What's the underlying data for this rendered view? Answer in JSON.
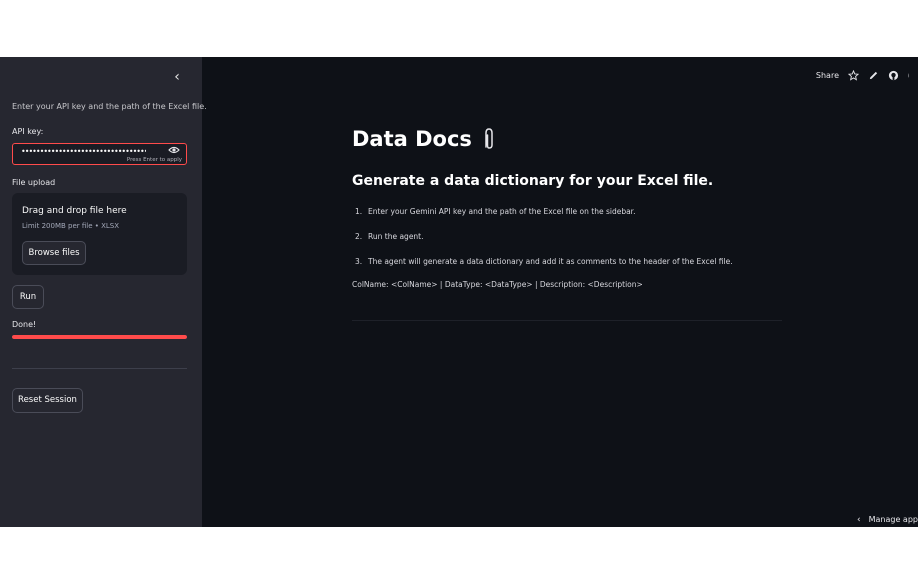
{
  "sidebar": {
    "collapse_icon": "chevron-left-icon",
    "intro": "Enter your API key and the path of the Excel file.",
    "api_key": {
      "label": "API key:",
      "value": "••••••••••••••••••••••••••••••••••••••",
      "hint": "Press Enter to apply"
    },
    "file_upload": {
      "label": "File upload",
      "drop_title": "Drag and drop file here",
      "limit": "Limit 200MB per file • XLSX",
      "browse_label": "Browse files"
    },
    "run_label": "Run",
    "status_label": "Done!",
    "progress": 1.0,
    "reset_label": "Reset Session"
  },
  "toolbar": {
    "share_label": "Share",
    "icons": [
      "star-icon",
      "edit-icon",
      "github-icon",
      "more-icon"
    ]
  },
  "main": {
    "title": "Data Docs",
    "title_emoji": "clip-icon",
    "subtitle": "Generate a data dictionary for your Excel file.",
    "steps": [
      {
        "num": "1.",
        "text": "Enter your Gemini API key and the path of the Excel file on the sidebar."
      },
      {
        "num": "2.",
        "text": "Run the agent."
      },
      {
        "num": "3.",
        "text": "The agent will generate a data dictionary and add it as comments to the header of the Excel file."
      }
    ],
    "format_line": "ColName: <ColName> | DataType: <DataType> | Description: <Description>",
    "manage_app": "Manage app"
  },
  "colors": {
    "accent": "#ff4b4b",
    "sidebar_bg": "#262730",
    "main_bg": "#0e1117"
  }
}
